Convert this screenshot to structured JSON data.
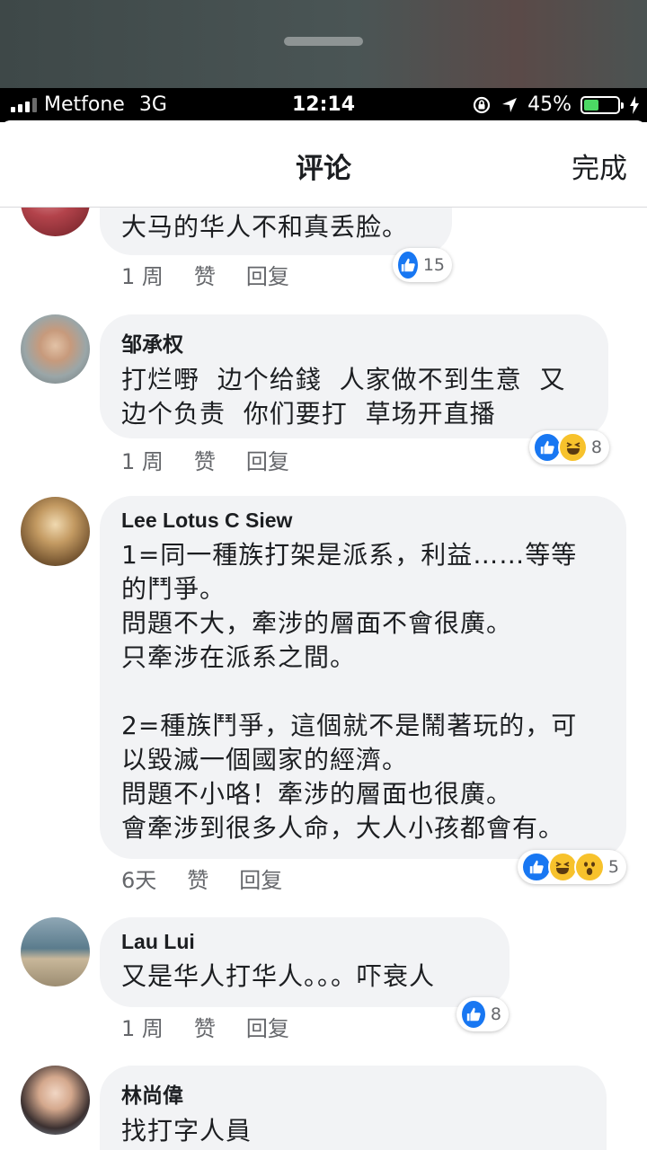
{
  "status": {
    "carrier": "Metfone",
    "network": "3G",
    "time": "12:14",
    "battery": "45%",
    "battery_level": 0.45
  },
  "header": {
    "title": "评论",
    "done": "完成"
  },
  "comments": [
    {
      "name": "",
      "text": "大马的华人不和真丢脸。",
      "time": "1 周",
      "like": "赞",
      "reply": "回复",
      "reactions": [
        "like"
      ],
      "count": "15"
    },
    {
      "name": "邹承权",
      "text": "打烂嘢  边个给錢  人家做不到生意  又\n边个负责  你们要打  草场开直播",
      "time": "1 周",
      "like": "赞",
      "reply": "回复",
      "reactions": [
        "like",
        "haha"
      ],
      "count": "8"
    },
    {
      "name": "Lee Lotus C Siew",
      "text": "1=同一種族打架是派系，利益……等等\n的鬥爭。\n問題不大，牽涉的層面不會很廣。\n只牽涉在派系之間。\n\n2=種族鬥爭，這個就不是鬧著玩的，可\n以毀滅一個國家的經濟。\n問題不小咯！牽涉的層面也很廣。\n會牽涉到很多人命，大人小孩都會有。",
      "time": "6天",
      "like": "赞",
      "reply": "回复",
      "reactions": [
        "like",
        "haha",
        "wow"
      ],
      "count": "5"
    },
    {
      "name": "Lau Lui",
      "text": "又是华人打华人。。。吓衰人",
      "time": "1 周",
      "like": "赞",
      "reply": "回复",
      "reactions": [
        "like"
      ],
      "count": "8"
    },
    {
      "name": "林尚偉",
      "text": "找打字人員",
      "time": "",
      "like": "",
      "reply": "",
      "reactions": [],
      "count": ""
    }
  ]
}
